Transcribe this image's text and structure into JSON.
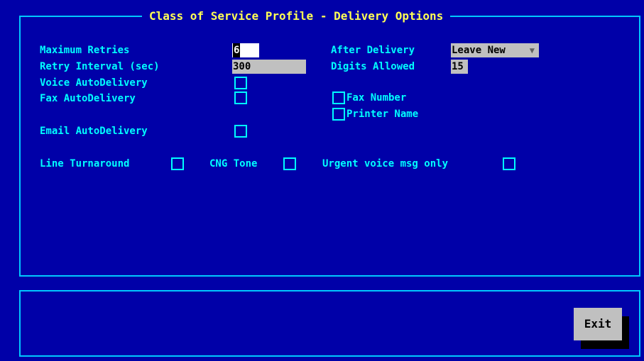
{
  "dialog": {
    "title": "Class of Service Profile - Delivery Options"
  },
  "fields": {
    "max_retries": {
      "label": "Maximum Retries",
      "value": "6"
    },
    "retry_interval": {
      "label": "Retry Interval (sec)",
      "value": "300"
    },
    "voice_autodelivery": {
      "label": "Voice AutoDelivery",
      "checked": false
    },
    "fax_autodelivery": {
      "label": "Fax AutoDelivery",
      "checked": false
    },
    "email_autodelivery": {
      "label": "Email AutoDelivery",
      "checked": false
    },
    "after_delivery": {
      "label": "After Delivery",
      "value": "Leave New"
    },
    "digits_allowed": {
      "label": "Digits Allowed",
      "value": "15"
    },
    "fax_number": {
      "label": "Fax Number",
      "checked": false
    },
    "printer_name": {
      "label": "Printer Name",
      "checked": false
    },
    "line_turnaround": {
      "label": "Line Turnaround",
      "checked": false
    },
    "cng_tone": {
      "label": "CNG Tone",
      "checked": false
    },
    "urgent_voice_only": {
      "label": "Urgent voice msg only",
      "checked": false
    }
  },
  "buttons": {
    "exit": "Exit"
  },
  "colors": {
    "background": "#0000a8",
    "border": "#00c8ff",
    "label": "#00ffff",
    "title": "#ffff55",
    "field": "#c0c0c0"
  },
  "icons": {
    "dropdown": "triangle-down"
  }
}
